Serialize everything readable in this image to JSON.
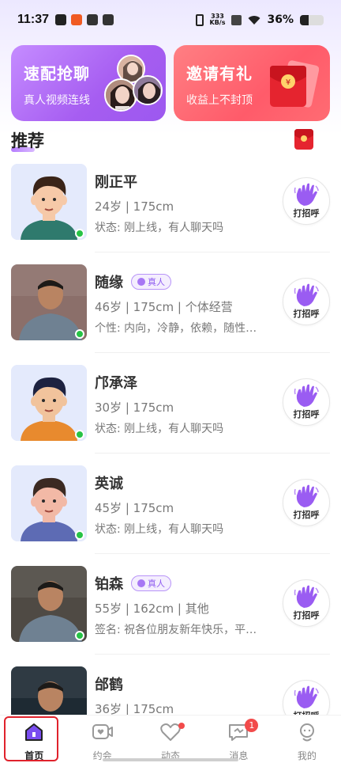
{
  "status_bar": {
    "time": "11:37",
    "net_speed_top": "333",
    "net_speed_bottom": "KB/s",
    "battery_percent": "36%",
    "battery_level": 0.36
  },
  "banners": {
    "left": {
      "title": "速配抢聊",
      "subtitle": "真人视频连线",
      "color": "#a65df1"
    },
    "right": {
      "title": "邀请有礼",
      "subtitle": "收益上不封顶",
      "color": "#ff5b6a"
    }
  },
  "section": {
    "title": "推荐"
  },
  "users": [
    {
      "name": "刚正平",
      "badge": "",
      "info": "24岁 | 175cm",
      "desc": "状态: 刚上线，有人聊天吗",
      "greet": "打招呼",
      "avatar": "cartoon",
      "skin": "#f6c9a8",
      "shirt": "#2f7a6d",
      "hair": "#3a2418"
    },
    {
      "name": "随缘",
      "badge": "真人",
      "info": "46岁 | 175cm | 个体经营",
      "desc": "个性: 内向，冷静，依赖，随性…",
      "greet": "打招呼",
      "avatar": "photo",
      "bg": "#8b6f6a"
    },
    {
      "name": "邝承泽",
      "badge": "",
      "info": "30岁 | 175cm",
      "desc": "状态: 刚上线，有人聊天吗",
      "greet": "打招呼",
      "avatar": "cartoon",
      "skin": "#f1c39c",
      "shirt": "#e88a2e",
      "hair": "#1d2240"
    },
    {
      "name": "英诚",
      "badge": "",
      "info": "45岁 | 175cm",
      "desc": "状态: 刚上线，有人聊天吗",
      "greet": "打招呼",
      "avatar": "cartoon",
      "skin": "#f2b9a6",
      "shirt": "#5d6bb4",
      "hair": "#3b2a22"
    },
    {
      "name": "铂森",
      "badge": "真人",
      "info": "55岁 | 162cm | 其他",
      "desc": "签名: 祝各位朋友新年快乐，平…",
      "greet": "打招呼",
      "avatar": "photo",
      "bg": "#4f4a44"
    },
    {
      "name": "邰鹤",
      "badge": "",
      "info": "36岁 | 175cm",
      "desc": "",
      "greet": "打招呼",
      "avatar": "photo",
      "bg": "#1e2a33"
    }
  ],
  "nav": [
    {
      "label": "首页",
      "icon": "home-icon",
      "active": true,
      "badge": "",
      "dot": false
    },
    {
      "label": "约会",
      "icon": "video-heart-icon",
      "active": false,
      "badge": "",
      "dot": false
    },
    {
      "label": "动态",
      "icon": "heart-icon",
      "active": false,
      "badge": "",
      "dot": true
    },
    {
      "label": "消息",
      "icon": "message-icon",
      "active": false,
      "badge": "1",
      "dot": false
    },
    {
      "label": "我的",
      "icon": "profile-icon",
      "active": false,
      "badge": "",
      "dot": false
    }
  ]
}
